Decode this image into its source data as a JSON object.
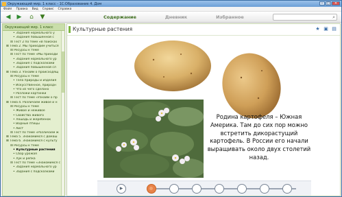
{
  "window": {
    "title": "Окружающий мир. 1 класс - 1С:Образование 4. Дом"
  },
  "menu": [
    "Файл",
    "Правка",
    "Вид",
    "Сервис",
    "Справка"
  ],
  "tabs": [
    "Содержание",
    "Дневник",
    "Избранное"
  ],
  "sidebar": {
    "header": "Окружающий мир. 1 класс",
    "items": [
      {
        "label": "Задания нормального у",
        "level": 3
      },
      {
        "label": "Задания повышенной с",
        "level": 3
      },
      {
        "label": "Тест 2 по теме «В поисках",
        "level": 2
      },
      {
        "label": "Тема 2. Мы приходим учиться",
        "level": 1
      },
      {
        "label": "Ресурсы к теме",
        "level": 2
      },
      {
        "label": "Тест по теме «Мы приходи",
        "level": 2
      },
      {
        "label": "Задания нормального ур",
        "level": 3
      },
      {
        "label": "Задания с подсказками",
        "level": 3
      },
      {
        "label": "Задания повышенной сл",
        "level": 3
      },
      {
        "label": "Тема 3. Узнайм о происходящ",
        "level": 1
      },
      {
        "label": "Ресурсы к теме",
        "level": 2
      },
      {
        "label": "Тела природы и изделия",
        "level": 3
      },
      {
        "label": "Искусственное, природн",
        "level": 3
      },
      {
        "label": "Что из чего сделано",
        "level": 3
      },
      {
        "label": "Разложи картинки",
        "level": 3
      },
      {
        "label": "Тест по теме «Узнайм о пр",
        "level": 2
      },
      {
        "label": "Тема 4. Различаем живое и н",
        "level": 1
      },
      {
        "label": "Ресурсы к теме",
        "level": 2
      },
      {
        "label": "Живое и неживое",
        "level": 3
      },
      {
        "label": "Свойства живого",
        "level": 3
      },
      {
        "label": "Лошадь и жеребёнок",
        "level": 3
      },
      {
        "label": "Водные птицы",
        "level": 3
      },
      {
        "label": "Аист",
        "level": 3
      },
      {
        "label": "Тест по теме «Различаем ж",
        "level": 2
      },
      {
        "label": "Тема 5. Знакомимся с домаш",
        "level": 1
      },
      {
        "label": "Тема 6. Знакомимся с культу",
        "level": 1
      },
      {
        "label": "Ресурсы к теме",
        "level": 2
      },
      {
        "label": "Культурные растения",
        "level": 3,
        "selected": true
      },
      {
        "label": "Сбор урожая",
        "level": 3
      },
      {
        "label": "Лук и репка",
        "level": 3
      },
      {
        "label": "Тест по теме «Знакомимся с",
        "level": 2
      },
      {
        "label": "Задания нормального ур",
        "level": 3
      },
      {
        "label": "Задания с подсказками",
        "level": 3
      }
    ]
  },
  "main": {
    "title": "Культурные растения",
    "caption": "Родина картофеля – Южная Америка. Там до сих пор можно встретить дикорастущий картофель. В России его начали выращивать около двух столетий назад."
  },
  "player": {
    "steps": 7,
    "current": 1
  },
  "colors": {
    "accent": "#7ab33d",
    "current_step": "#e8834a",
    "sidebar_bg": "#e4efcf"
  }
}
